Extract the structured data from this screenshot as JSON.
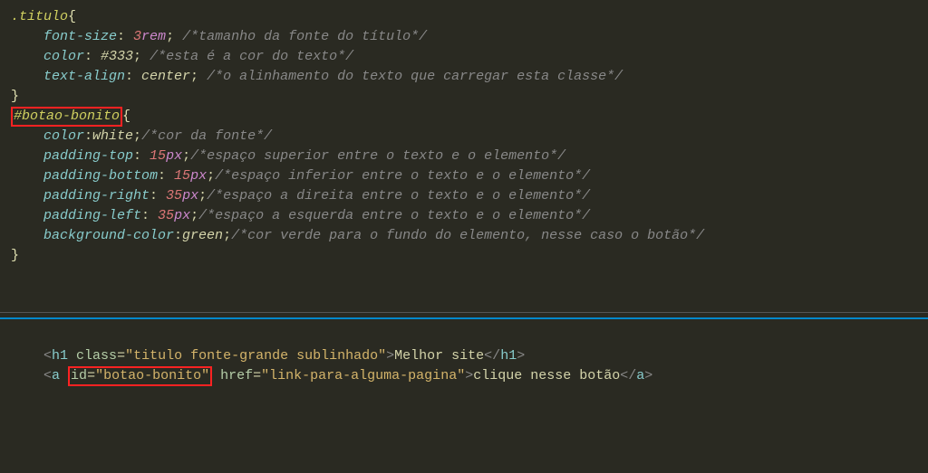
{
  "css": {
    "rule1": {
      "selector": ".titulo",
      "d1_prop": "font-size",
      "d1_val_num": "3",
      "d1_val_unit": "rem",
      "d1_c": "/*tamanho da fonte do título*/",
      "d2_prop": "color",
      "d2_val": "#333",
      "d2_c": "/*esta é a cor do texto*/",
      "d3_prop": "text-align",
      "d3_val": "center",
      "d3_c": "/*o alinhamento do texto que carregar esta classe*/"
    },
    "rule2": {
      "selector": "#botao-bonito",
      "d1_prop": "color",
      "d1_val": "white",
      "d1_c": "/*cor da fonte*/",
      "d2_prop": "padding-top",
      "d2_num": "15",
      "d2_unit": "px",
      "d2_c": "/*espaço superior entre o texto e o elemento*/",
      "d3_prop": "padding-bottom",
      "d3_num": "15",
      "d3_unit": "px",
      "d3_c": "/*espaço inferior entre o texto e o elemento*/",
      "d4_prop": "padding-right",
      "d4_num": "35",
      "d4_unit": "px",
      "d4_c": "/*espaço a direita entre o texto e o elemento*/",
      "d5_prop": "padding-left",
      "d5_num": "35",
      "d5_unit": "px",
      "d5_c": "/*espaço a esquerda entre o texto e o elemento*/",
      "d6_prop": "background-color",
      "d6_val": "green",
      "d6_c": "/*cor verde para o fundo do elemento, nesse caso o botão*/"
    }
  },
  "html": {
    "h1_tag": "h1",
    "h1_attr_class": "class",
    "h1_class_val": "\"titulo fonte-grande sublinhado\"",
    "h1_text": "Melhor site",
    "a_tag": "a",
    "a_attr_id": "id",
    "a_id_val": "\"botao-bonito\"",
    "a_attr_href": "href",
    "a_href_val": "\"link-para-alguma-pagina\"",
    "a_text": "clique nesse botão"
  }
}
